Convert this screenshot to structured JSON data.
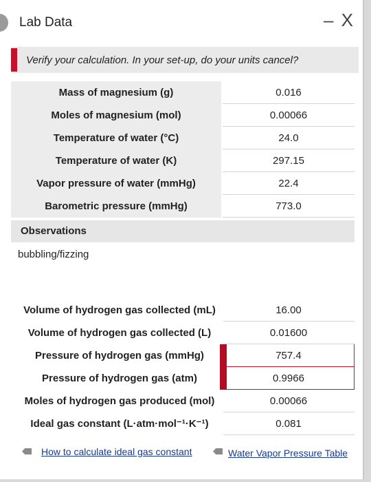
{
  "window": {
    "title": "Lab Data",
    "controls": "– X"
  },
  "verify": {
    "text": "Verify your calculation. In your set-up, do your units cancel?"
  },
  "table1": [
    {
      "label": "Mass of magnesium (g)",
      "value": "0.016"
    },
    {
      "label": "Moles of magnesium (mol)",
      "value": "0.00066"
    },
    {
      "label": "Temperature of water (°C)",
      "value": "24.0"
    },
    {
      "label": "Temperature of water (K)",
      "value": "297.15"
    },
    {
      "label": "Vapor pressure of water (mmHg)",
      "value": "22.4"
    },
    {
      "label": "Barometric pressure (mmHg)",
      "value": "773.0"
    }
  ],
  "observations": {
    "heading": "Observations",
    "text": "bubbling/fizzing"
  },
  "table2": [
    {
      "label": "Volume of hydrogen gas collected (mL)",
      "value": "16.00"
    },
    {
      "label": "Volume of hydrogen gas collected (L)",
      "value": "0.01600"
    },
    {
      "label": "Pressure of hydrogen gas (mmHg)",
      "value": "757.4"
    },
    {
      "label": "Pressure of hydrogen gas (atm)",
      "value": "0.9966"
    },
    {
      "label": "Moles of hydrogen gas produced (mol)",
      "value": "0.00066"
    },
    {
      "label": "Ideal gas constant (L·atm·mol⁻¹·K⁻¹)",
      "value": "0.081"
    }
  ],
  "links": {
    "ideal_gas": "How to calculate ideal gas constant",
    "water_vapor": "Water Vapor Pressure Table"
  },
  "colors": {
    "accent": "#c4112c",
    "link": "#1a3a8a"
  }
}
